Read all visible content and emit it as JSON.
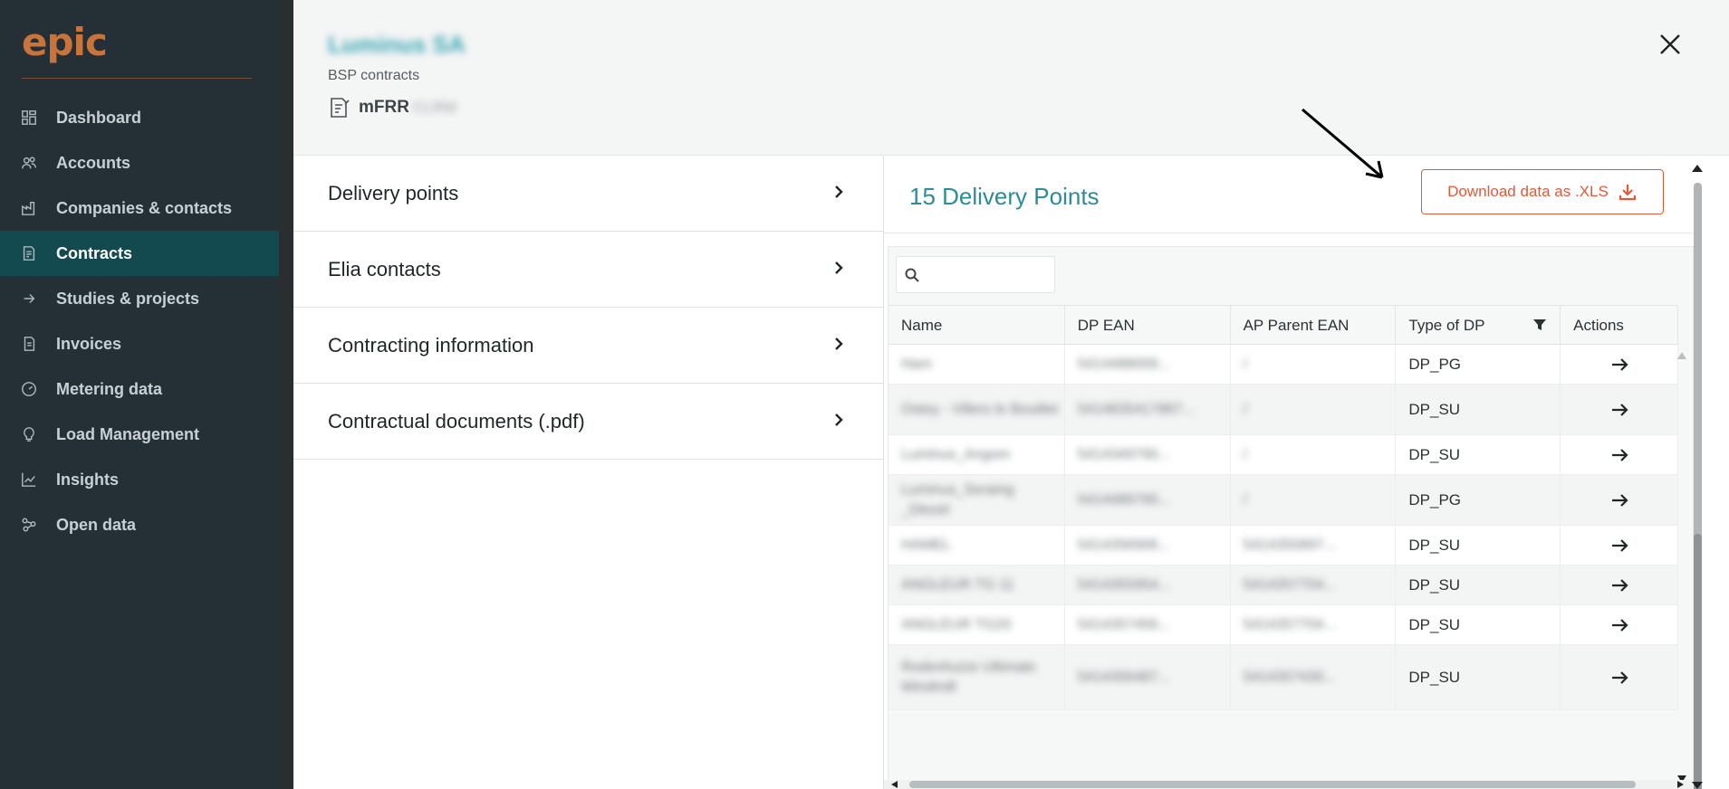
{
  "sidebar": {
    "logo": "epic",
    "items": [
      {
        "label": "Dashboard",
        "icon": "dashboard-icon"
      },
      {
        "label": "Accounts",
        "icon": "users-icon"
      },
      {
        "label": "Companies & contacts",
        "icon": "factory-icon"
      },
      {
        "label": "Contracts",
        "icon": "contract-icon",
        "active": true
      },
      {
        "label": "Studies & projects",
        "icon": "arrow-right-icon"
      },
      {
        "label": "Invoices",
        "icon": "invoice-icon"
      },
      {
        "label": "Metering data",
        "icon": "gauge-icon"
      },
      {
        "label": "Load Management",
        "icon": "bulb-icon"
      },
      {
        "label": "Insights",
        "icon": "chart-line-icon"
      },
      {
        "label": "Open data",
        "icon": "network-icon"
      }
    ]
  },
  "header": {
    "company": "Luminus SA",
    "subtitle": "BSP contracts",
    "contract": "mFRR",
    "contract_suffix": "CLRM"
  },
  "menu": {
    "items": [
      {
        "label": "Delivery points"
      },
      {
        "label": "Elia contacts"
      },
      {
        "label": "Contracting information"
      },
      {
        "label": "Contractual documents (.pdf)"
      }
    ]
  },
  "panel": {
    "title": "15 Delivery Points",
    "download_label": "Download data as .XLS",
    "search_placeholder": ""
  },
  "table": {
    "columns": [
      "Name",
      "DP EAN",
      "AP Parent EAN",
      "Type of DP",
      "Actions"
    ],
    "rows": [
      {
        "name": "Ham",
        "dp_ean": "5414488009...",
        "ap_ean": "/",
        "type": "DP_PG",
        "height": 44
      },
      {
        "name": "Ostey - Villers le Bouillet",
        "dp_ean": "5414835417887...",
        "ap_ean": "/",
        "type": "DP_SU",
        "height": 56
      },
      {
        "name": "Luminus_Angom",
        "dp_ean": "5414349790...",
        "ap_ean": "/",
        "type": "DP_SU",
        "height": 44
      },
      {
        "name": "Luminus_Seraing _Diesel",
        "dp_ean": "5414489790...",
        "ap_ean": "/",
        "type": "DP_PG",
        "height": 56
      },
      {
        "name": "HAMEL",
        "dp_ean": "5414356906...",
        "ap_ean": "5414355897...",
        "type": "DP_SU",
        "height": 44
      },
      {
        "name": "ANGLEUR TG 11",
        "dp_ean": "5414355954...",
        "ap_ean": "5414357704...",
        "type": "DP_SU",
        "height": 44
      },
      {
        "name": "ANGLEUR TG20",
        "dp_ean": "5414357456...",
        "ap_ean": "5414357704...",
        "type": "DP_SU",
        "height": 44
      },
      {
        "name": "Rodenhuize Ultimate Windmill",
        "dp_ean": "5414356487...",
        "ap_ean": "5414357430...",
        "type": "DP_SU",
        "height": 72
      }
    ]
  },
  "colors": {
    "sidebar_bg": "#243035",
    "active_bg": "#134a50",
    "accent": "#2a8c98",
    "download": "#e2583a"
  }
}
